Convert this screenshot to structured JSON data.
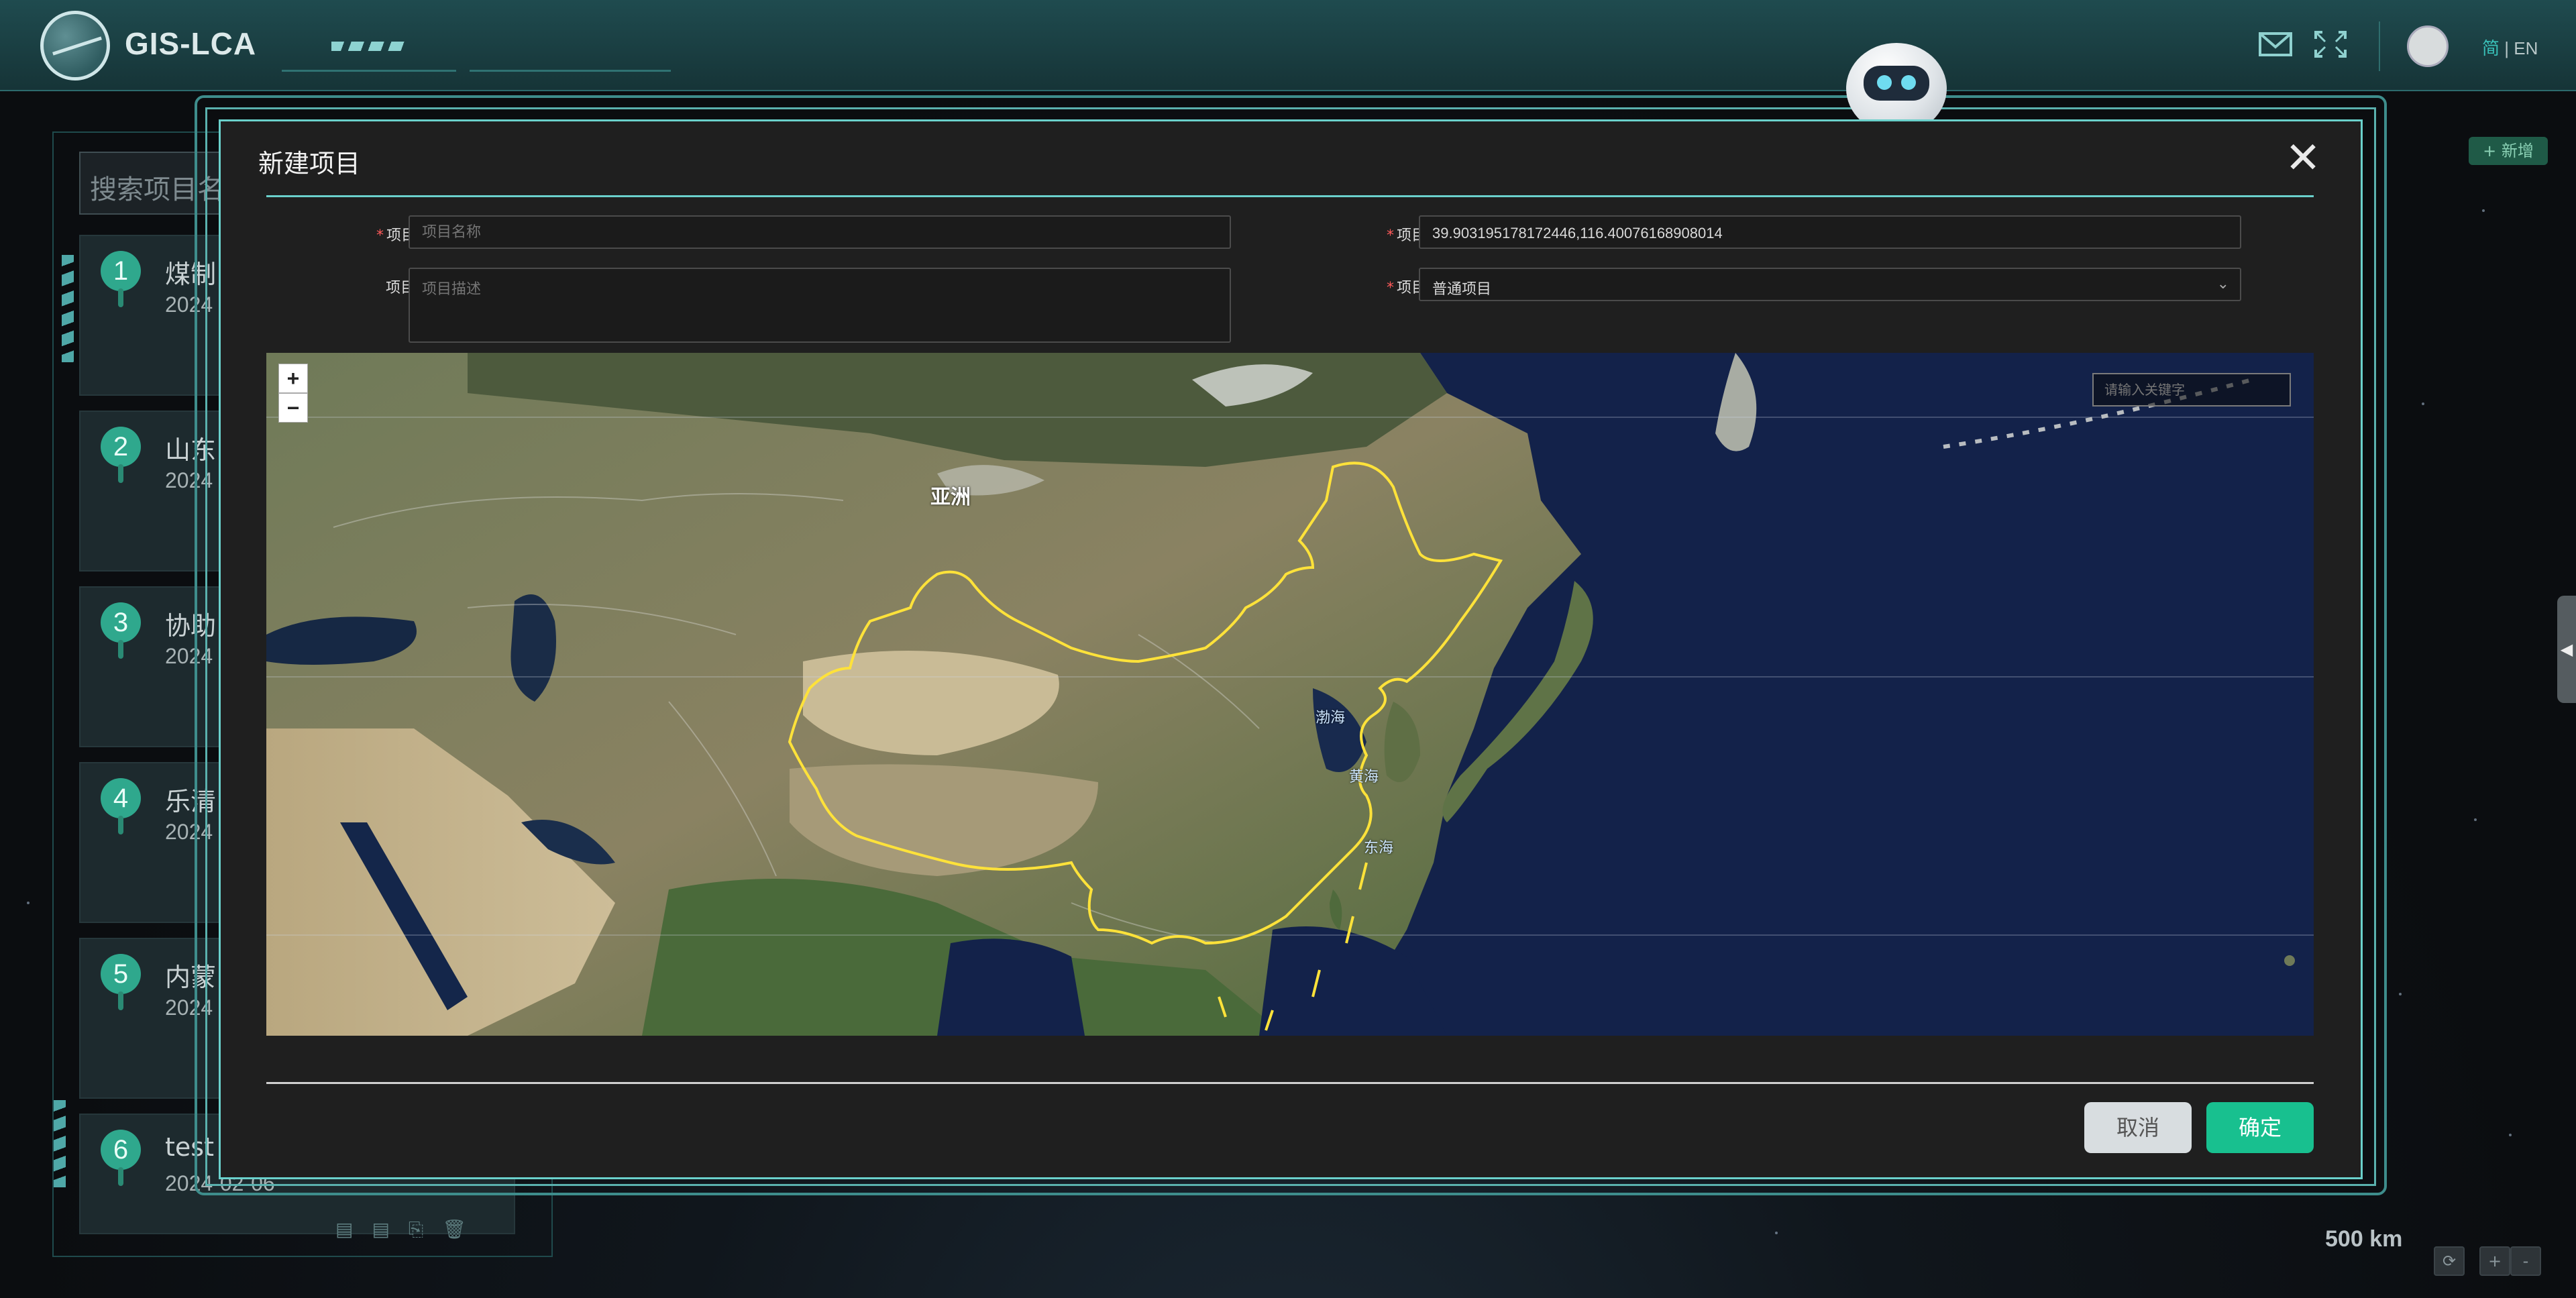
{
  "app": {
    "logo_text": "GIS-LCA",
    "lang_cn": "简",
    "lang_sep": "|",
    "lang_en": "EN"
  },
  "sidebar": {
    "search_placeholder": "搜索项目名",
    "items": [
      {
        "num": "1",
        "title": "煤制",
        "date": "2024"
      },
      {
        "num": "2",
        "title": "山东",
        "date": "2024"
      },
      {
        "num": "3",
        "title": "协助",
        "date": "2024"
      },
      {
        "num": "4",
        "title": "乐清",
        "date": "2024"
      },
      {
        "num": "5",
        "title": "内蒙",
        "date": "2024"
      },
      {
        "num": "6",
        "title": "test",
        "date": "2024-02-06"
      }
    ]
  },
  "right": {
    "add_label": "+ 新增",
    "collapse_glyph": "◀",
    "scale_label": "500 km",
    "refresh_glyph": "⟳",
    "zoom_in_glyph": "+",
    "zoom_out_glyph": "-"
  },
  "modal": {
    "title": "新建项目",
    "close_glyph": "✕",
    "name_label": "项目名称",
    "name_placeholder": "项目名称",
    "desc_label": "项目描述",
    "desc_placeholder": "项目描述",
    "location_label": "项目位置",
    "location_value": "39.903195178172446,116.40076168908014",
    "type_label": "项目类型",
    "type_value": "普通项目",
    "cancel_label": "取消",
    "ok_label": "确定"
  },
  "map": {
    "zoom_in": "+",
    "zoom_out": "−",
    "search_placeholder": "请输入关键字",
    "labels": {
      "asia": "亚洲",
      "bohai": "渤海",
      "yellow_sea": "黄海",
      "east_sea": "东海"
    }
  },
  "colors": {
    "accent": "#18c08f",
    "frame": "#6ad0cb",
    "border_line": "#ffe23a",
    "header_bg": "#1f4b4f"
  },
  "icons": {
    "mail": "mail-icon",
    "fullscreen": "fullscreen-icon",
    "avatar": "avatar-icon",
    "robot": "robot-assistant-icon"
  }
}
